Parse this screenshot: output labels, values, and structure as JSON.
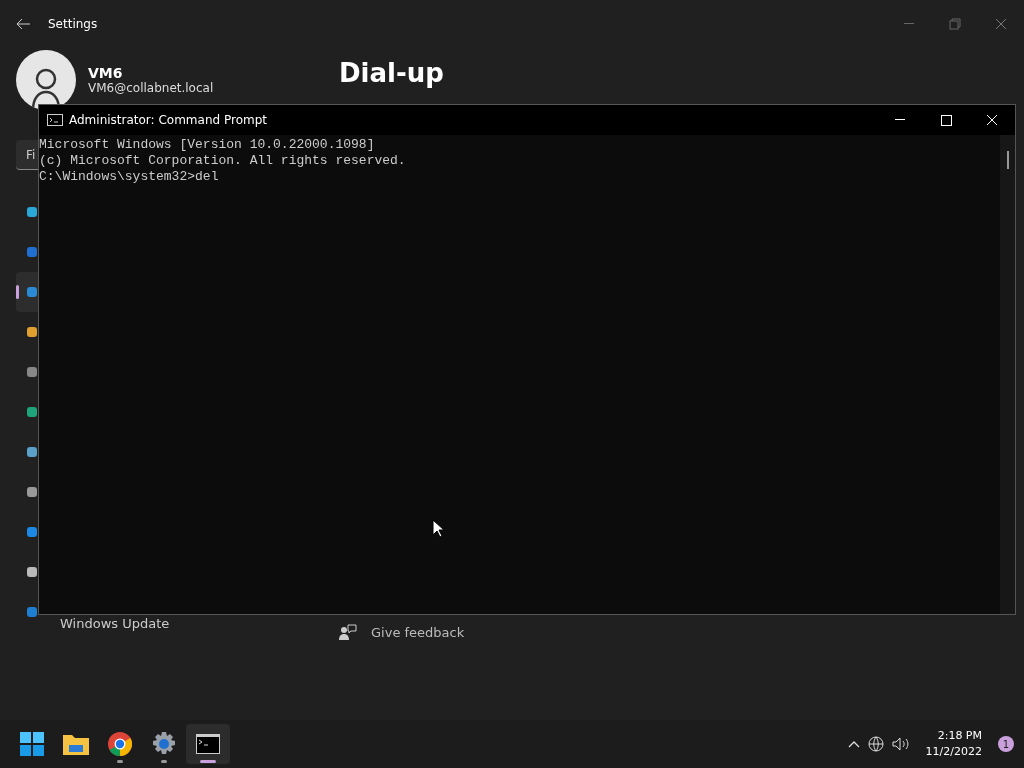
{
  "settings_window": {
    "title": "Settings",
    "user": {
      "name": "VM6",
      "email": "VM6@collabnet.local"
    },
    "search": {
      "placeholder": "Fi"
    },
    "sidebar_items": [
      {
        "selected": false
      },
      {
        "selected": false
      },
      {
        "selected": true
      },
      {
        "selected": false
      },
      {
        "selected": false
      },
      {
        "selected": false
      },
      {
        "selected": false
      },
      {
        "selected": false
      },
      {
        "selected": false
      },
      {
        "selected": false
      },
      {
        "label": "Windows Update",
        "selected": false
      }
    ],
    "page_title": "Dial-up",
    "feedback_link": "Give feedback"
  },
  "command_prompt": {
    "title": "Administrator: Command Prompt",
    "lines": [
      "Microsoft Windows [Version 10.0.22000.1098]",
      "(c) Microsoft Corporation. All rights reserved.",
      "C:\\Windows\\system32>del"
    ]
  },
  "taskbar": {
    "apps": [
      {
        "kind": "start",
        "running": false,
        "active": false
      },
      {
        "kind": "explorer",
        "running": false,
        "active": false
      },
      {
        "kind": "chrome",
        "running": true,
        "active": false
      },
      {
        "kind": "settings",
        "running": true,
        "active": false
      },
      {
        "kind": "terminal",
        "running": true,
        "active": true
      }
    ],
    "time": "2:18 PM",
    "date": "11/2/2022",
    "notification_count": "1"
  }
}
